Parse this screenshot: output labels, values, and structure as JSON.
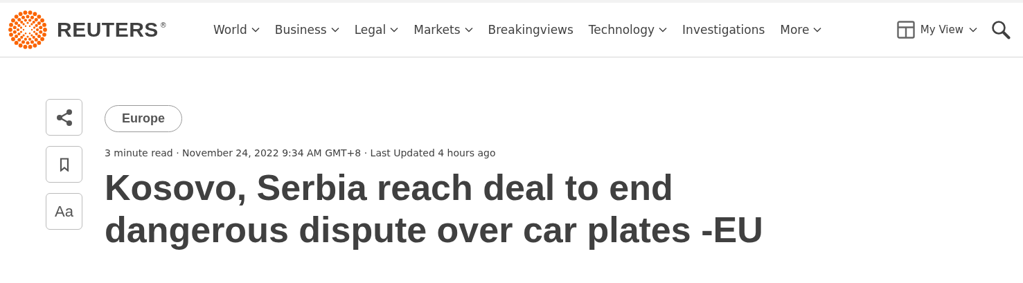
{
  "header": {
    "logo": "REUTERS",
    "logo_mark": "®",
    "nav": [
      {
        "label": "World",
        "dropdown": true
      },
      {
        "label": "Business",
        "dropdown": true
      },
      {
        "label": "Legal",
        "dropdown": true
      },
      {
        "label": "Markets",
        "dropdown": true
      },
      {
        "label": "Breakingviews",
        "dropdown": false
      },
      {
        "label": "Technology",
        "dropdown": true
      },
      {
        "label": "Investigations",
        "dropdown": false
      },
      {
        "label": "More",
        "dropdown": true
      }
    ],
    "my_view": "My View"
  },
  "article": {
    "tag": "Europe",
    "meta": "3 minute read · November 24, 2022 9:34 AM GMT+8 · Last Updated 4 hours ago",
    "headline": "Kosovo, Serbia reach deal to end dangerous dispute over car plates -EU",
    "text_size_button": "Aa"
  }
}
